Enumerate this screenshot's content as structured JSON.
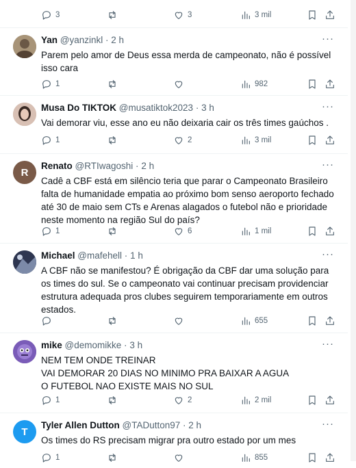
{
  "tweets": [
    {
      "name": "",
      "handle": "",
      "time": "",
      "text": "",
      "reply_count": "3",
      "retweet_count": "",
      "like_count": "3",
      "views": "3 mil"
    },
    {
      "name": "Yan",
      "handle": "@yanzinkl",
      "time": "2 h",
      "text": "Parem pelo amor de Deus essa merda de campeonato, não é possível isso cara",
      "reply_count": "1",
      "retweet_count": "",
      "like_count": "",
      "views": "982",
      "avatar_color": "#8b7a63"
    },
    {
      "name": "Musa Do TIKTOK",
      "handle": "@musatiktok2023",
      "time": "3 h",
      "text": "Vai demorar viu, esse ano eu não deixaria cair os três times gaúchos .",
      "reply_count": "1",
      "retweet_count": "",
      "like_count": "2",
      "views": "3 mil",
      "avatar_color": "#c9a89a"
    },
    {
      "name": "Renato",
      "handle": "@RTIwagoshi",
      "time": "2 h",
      "text": "Cadê a CBF está em silêncio teria que parar o Campeonato Brasileiro falta de humanidade empatia ao próximo bom senso aeroporto fechado até 30 de maio sem CTs e Arenas alagados o futebol não e prioridade neste momento na região Sul do país?",
      "reply_count": "1",
      "retweet_count": "",
      "like_count": "6",
      "views": "1 mil",
      "avatar_letter": "R",
      "avatar_color": "#7a5a48"
    },
    {
      "name": "Michael",
      "handle": "@mafehell",
      "time": "1 h",
      "text": "A CBF não se manifestou? É obrigação da CBF dar uma solução para os times do sul. Se o campeonato vai continuar precisam providenciar estrutura adequada pros clubes seguirem temporariamente em outros estados.",
      "reply_count": "",
      "retweet_count": "",
      "like_count": "",
      "views": "655",
      "avatar_color": "#3d4a66"
    },
    {
      "name": "mike",
      "handle": "@demomikke",
      "time": "3 h",
      "text": "NEM TEM ONDE TREINAR\nVAI DEMORAR 20 DIAS NO MINIMO PRA BAIXAR A AGUA\nO FUTEBOL NAO EXISTE MAIS NO SUL",
      "reply_count": "1",
      "retweet_count": "",
      "like_count": "2",
      "views": "2 mil",
      "avatar_color": "#6a4fa0"
    },
    {
      "name": "Tyler Allen Dutton",
      "handle": "@TADutton97",
      "time": "2 h",
      "text": "Os times do RS precisam migrar pra outro estado por um mes",
      "reply_count": "1",
      "retweet_count": "",
      "like_count": "",
      "views": "855",
      "avatar_letter": "T",
      "avatar_color": "#1d9bf0"
    }
  ]
}
